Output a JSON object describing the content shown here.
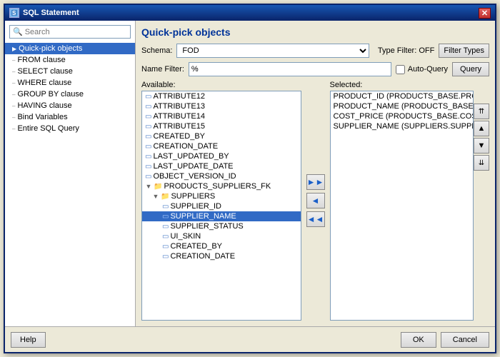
{
  "window": {
    "title": "SQL Statement",
    "close_label": "✕"
  },
  "search": {
    "placeholder": "Search"
  },
  "sidebar": {
    "items": [
      {
        "label": "Quick-pick objects",
        "active": true
      },
      {
        "label": "FROM clause",
        "active": false
      },
      {
        "label": "SELECT clause",
        "active": false
      },
      {
        "label": "WHERE clause",
        "active": false
      },
      {
        "label": "GROUP BY clause",
        "active": false
      },
      {
        "label": "HAVING clause",
        "active": false
      },
      {
        "label": "Bind Variables",
        "active": false
      },
      {
        "label": "Entire SQL Query",
        "active": false
      }
    ]
  },
  "main": {
    "title": "Quick-pick objects",
    "schema_label": "Schema:",
    "schema_value": "FOD",
    "type_filter_label": "Type Filter: OFF",
    "filter_types_btn": "Filter Types",
    "name_filter_label": "Name Filter:",
    "name_filter_value": "%",
    "auto_query_label": "Auto-Query",
    "query_btn": "Query",
    "available_label": "Available:",
    "selected_label": "Selected:",
    "available_items": [
      {
        "label": "ATTRIBUTE12",
        "indent": 0,
        "type": "table"
      },
      {
        "label": "ATTRIBUTE13",
        "indent": 0,
        "type": "table"
      },
      {
        "label": "ATTRIBUTE14",
        "indent": 0,
        "type": "table"
      },
      {
        "label": "ATTRIBUTE15",
        "indent": 0,
        "type": "table"
      },
      {
        "label": "CREATED_BY",
        "indent": 0,
        "type": "table"
      },
      {
        "label": "CREATION_DATE",
        "indent": 0,
        "type": "table"
      },
      {
        "label": "LAST_UPDATED_BY",
        "indent": 0,
        "type": "table"
      },
      {
        "label": "LAST_UPDATE_DATE",
        "indent": 0,
        "type": "table"
      },
      {
        "label": "OBJECT_VERSION_ID",
        "indent": 0,
        "type": "table"
      },
      {
        "label": "PRODUCTS_SUPPLIERS_FK",
        "indent": 0,
        "type": "folder",
        "expand": "▼"
      },
      {
        "label": "SUPPLIERS",
        "indent": 1,
        "type": "folder",
        "expand": "▼"
      },
      {
        "label": "SUPPLIER_ID",
        "indent": 2,
        "type": "table"
      },
      {
        "label": "SUPPLIER_NAME",
        "indent": 2,
        "type": "table",
        "selected": true
      },
      {
        "label": "SUPPLIER_STATUS",
        "indent": 2,
        "type": "table"
      },
      {
        "label": "UI_SKIN",
        "indent": 2,
        "type": "table"
      },
      {
        "label": "CREATED_BY",
        "indent": 2,
        "type": "table"
      },
      {
        "label": "CREATION_DATE",
        "indent": 2,
        "type": "table"
      }
    ],
    "selected_items": [
      {
        "label": "PRODUCT_ID (PRODUCTS_BASE.PRODUCT_"
      },
      {
        "label": "PRODUCT_NAME (PRODUCTS_BASE.PRODU"
      },
      {
        "label": "COST_PRICE (PRODUCTS_BASE.COST_PRI"
      },
      {
        "label": "SUPPLIER_NAME (SUPPLIERS.SUPPLIER_NA"
      }
    ],
    "move_right_btn": "▶▶",
    "move_left_btn": "◀",
    "move_all_left_btn": "◀◀",
    "move_up_btn": "▲",
    "move_down_btn": "▼",
    "move_top_btn": "⇈",
    "move_bottom_btn": "⇊"
  },
  "footer": {
    "help_btn": "Help",
    "ok_btn": "OK",
    "cancel_btn": "Cancel"
  }
}
